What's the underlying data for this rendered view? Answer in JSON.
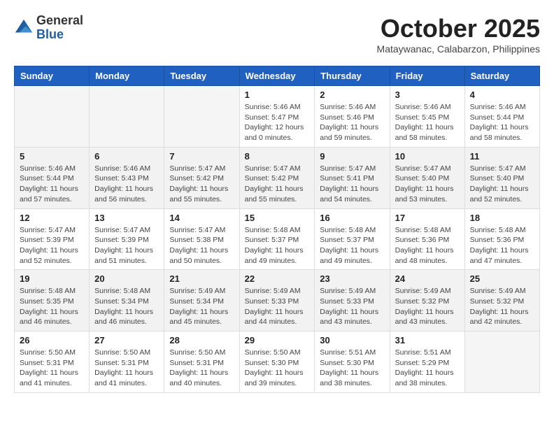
{
  "logo": {
    "general": "General",
    "blue": "Blue"
  },
  "title": "October 2025",
  "location": "Mataywanac, Calabarzon, Philippines",
  "weekdays": [
    "Sunday",
    "Monday",
    "Tuesday",
    "Wednesday",
    "Thursday",
    "Friday",
    "Saturday"
  ],
  "weeks": [
    [
      {
        "day": "",
        "info": ""
      },
      {
        "day": "",
        "info": ""
      },
      {
        "day": "",
        "info": ""
      },
      {
        "day": "1",
        "info": "Sunrise: 5:46 AM\nSunset: 5:47 PM\nDaylight: 12 hours\nand 0 minutes."
      },
      {
        "day": "2",
        "info": "Sunrise: 5:46 AM\nSunset: 5:46 PM\nDaylight: 11 hours\nand 59 minutes."
      },
      {
        "day": "3",
        "info": "Sunrise: 5:46 AM\nSunset: 5:45 PM\nDaylight: 11 hours\nand 58 minutes."
      },
      {
        "day": "4",
        "info": "Sunrise: 5:46 AM\nSunset: 5:44 PM\nDaylight: 11 hours\nand 58 minutes."
      }
    ],
    [
      {
        "day": "5",
        "info": "Sunrise: 5:46 AM\nSunset: 5:44 PM\nDaylight: 11 hours\nand 57 minutes."
      },
      {
        "day": "6",
        "info": "Sunrise: 5:46 AM\nSunset: 5:43 PM\nDaylight: 11 hours\nand 56 minutes."
      },
      {
        "day": "7",
        "info": "Sunrise: 5:47 AM\nSunset: 5:42 PM\nDaylight: 11 hours\nand 55 minutes."
      },
      {
        "day": "8",
        "info": "Sunrise: 5:47 AM\nSunset: 5:42 PM\nDaylight: 11 hours\nand 55 minutes."
      },
      {
        "day": "9",
        "info": "Sunrise: 5:47 AM\nSunset: 5:41 PM\nDaylight: 11 hours\nand 54 minutes."
      },
      {
        "day": "10",
        "info": "Sunrise: 5:47 AM\nSunset: 5:40 PM\nDaylight: 11 hours\nand 53 minutes."
      },
      {
        "day": "11",
        "info": "Sunrise: 5:47 AM\nSunset: 5:40 PM\nDaylight: 11 hours\nand 52 minutes."
      }
    ],
    [
      {
        "day": "12",
        "info": "Sunrise: 5:47 AM\nSunset: 5:39 PM\nDaylight: 11 hours\nand 52 minutes."
      },
      {
        "day": "13",
        "info": "Sunrise: 5:47 AM\nSunset: 5:39 PM\nDaylight: 11 hours\nand 51 minutes."
      },
      {
        "day": "14",
        "info": "Sunrise: 5:47 AM\nSunset: 5:38 PM\nDaylight: 11 hours\nand 50 minutes."
      },
      {
        "day": "15",
        "info": "Sunrise: 5:48 AM\nSunset: 5:37 PM\nDaylight: 11 hours\nand 49 minutes."
      },
      {
        "day": "16",
        "info": "Sunrise: 5:48 AM\nSunset: 5:37 PM\nDaylight: 11 hours\nand 49 minutes."
      },
      {
        "day": "17",
        "info": "Sunrise: 5:48 AM\nSunset: 5:36 PM\nDaylight: 11 hours\nand 48 minutes."
      },
      {
        "day": "18",
        "info": "Sunrise: 5:48 AM\nSunset: 5:36 PM\nDaylight: 11 hours\nand 47 minutes."
      }
    ],
    [
      {
        "day": "19",
        "info": "Sunrise: 5:48 AM\nSunset: 5:35 PM\nDaylight: 11 hours\nand 46 minutes."
      },
      {
        "day": "20",
        "info": "Sunrise: 5:48 AM\nSunset: 5:34 PM\nDaylight: 11 hours\nand 46 minutes."
      },
      {
        "day": "21",
        "info": "Sunrise: 5:49 AM\nSunset: 5:34 PM\nDaylight: 11 hours\nand 45 minutes."
      },
      {
        "day": "22",
        "info": "Sunrise: 5:49 AM\nSunset: 5:33 PM\nDaylight: 11 hours\nand 44 minutes."
      },
      {
        "day": "23",
        "info": "Sunrise: 5:49 AM\nSunset: 5:33 PM\nDaylight: 11 hours\nand 43 minutes."
      },
      {
        "day": "24",
        "info": "Sunrise: 5:49 AM\nSunset: 5:32 PM\nDaylight: 11 hours\nand 43 minutes."
      },
      {
        "day": "25",
        "info": "Sunrise: 5:49 AM\nSunset: 5:32 PM\nDaylight: 11 hours\nand 42 minutes."
      }
    ],
    [
      {
        "day": "26",
        "info": "Sunrise: 5:50 AM\nSunset: 5:31 PM\nDaylight: 11 hours\nand 41 minutes."
      },
      {
        "day": "27",
        "info": "Sunrise: 5:50 AM\nSunset: 5:31 PM\nDaylight: 11 hours\nand 41 minutes."
      },
      {
        "day": "28",
        "info": "Sunrise: 5:50 AM\nSunset: 5:31 PM\nDaylight: 11 hours\nand 40 minutes."
      },
      {
        "day": "29",
        "info": "Sunrise: 5:50 AM\nSunset: 5:30 PM\nDaylight: 11 hours\nand 39 minutes."
      },
      {
        "day": "30",
        "info": "Sunrise: 5:51 AM\nSunset: 5:30 PM\nDaylight: 11 hours\nand 38 minutes."
      },
      {
        "day": "31",
        "info": "Sunrise: 5:51 AM\nSunset: 5:29 PM\nDaylight: 11 hours\nand 38 minutes."
      },
      {
        "day": "",
        "info": ""
      }
    ]
  ]
}
